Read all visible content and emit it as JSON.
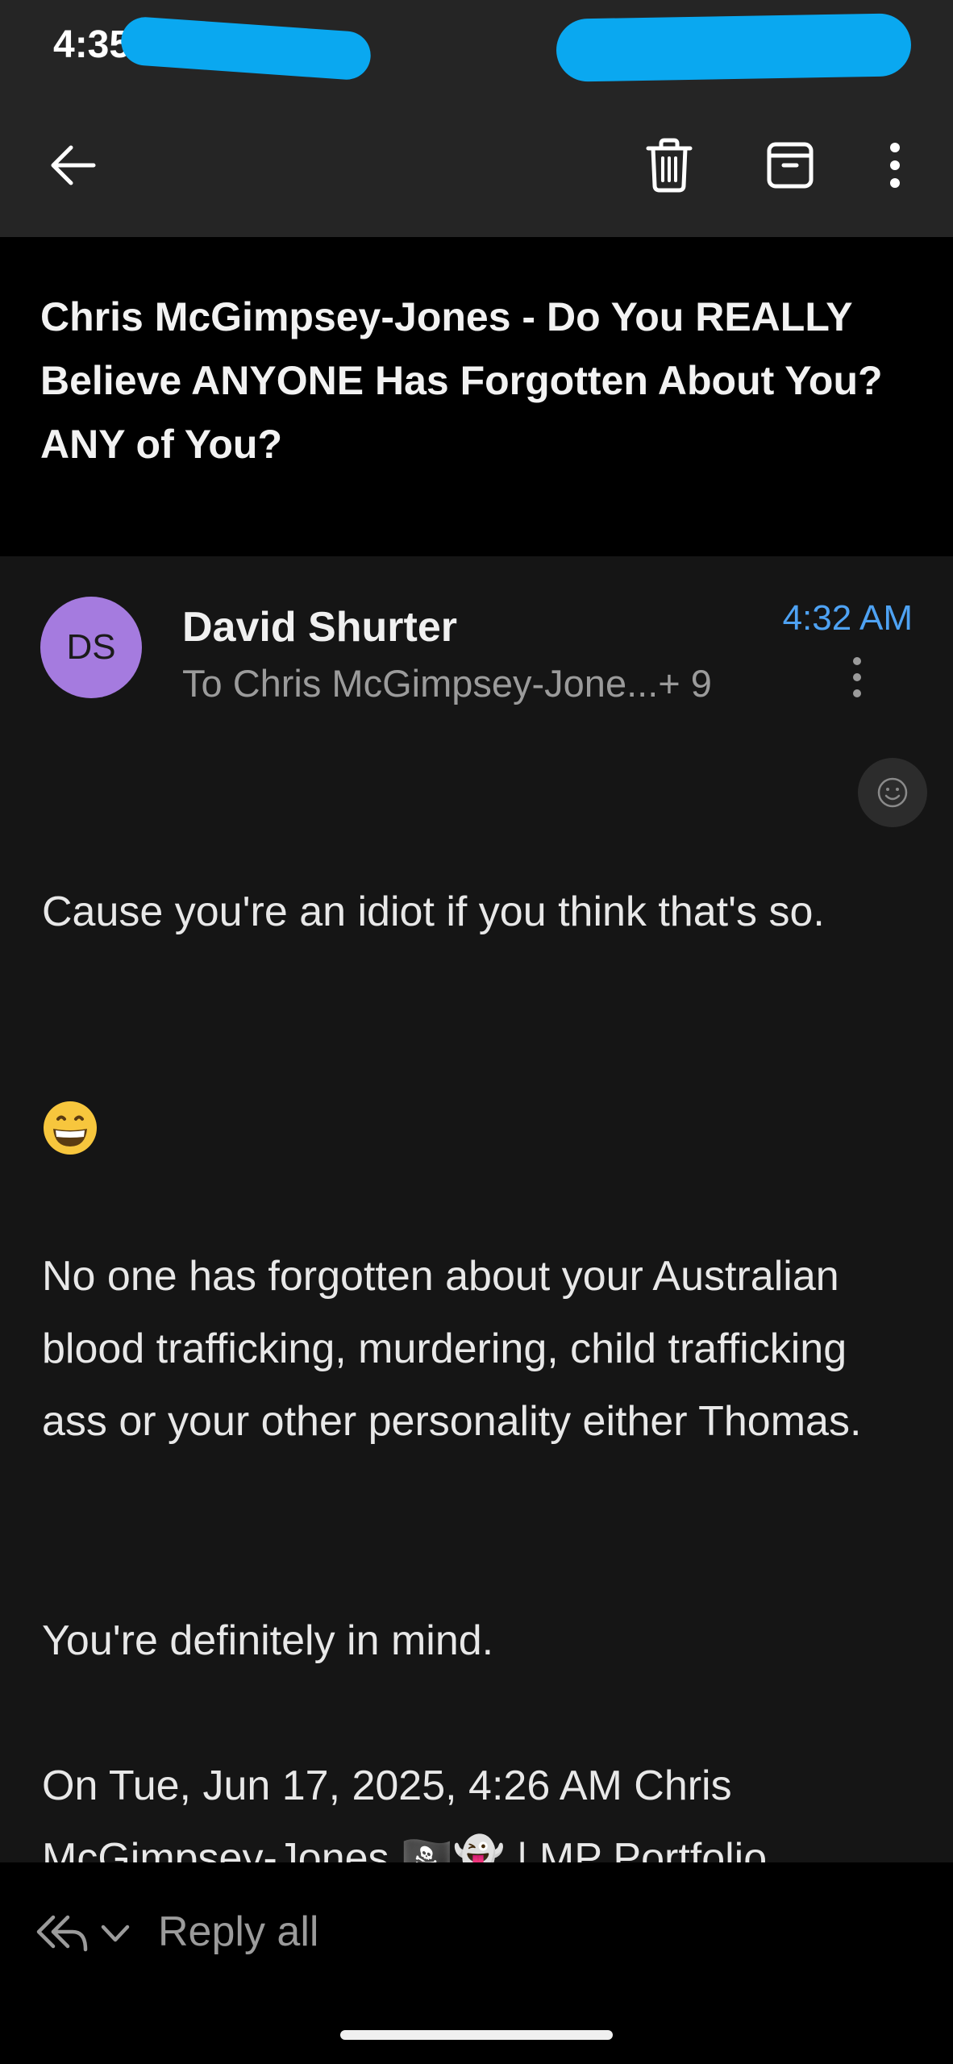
{
  "status_bar": {
    "time": "4:35"
  },
  "toolbar": {
    "back_icon": "arrow-left-icon",
    "delete_icon": "trash-icon",
    "archive_icon": "archive-icon",
    "more_icon": "more-vertical-icon"
  },
  "email": {
    "subject": "Chris McGimpsey-Jones - Do You REALLY Believe ANYONE Has Forgotten About You? ANY of You?",
    "avatar_initials": "DS",
    "sender": "David Shurter",
    "recipients": "To Chris McGimpsey-Jone...+ 9",
    "time": "4:32 AM",
    "body": {
      "p1": "Cause you're an idiot if you think that's so.",
      "emoji": "grinning-face-emoji",
      "p2": "No one has forgotten about your Australian blood trafficking, murdering, child trafficking ass or your other personality either Thomas.",
      "p3": "You're definitely in mind.",
      "p4_line1": "On Tue, Jun 17, 2025, 4:26 AM Chris",
      "p4_line2": "McGimpsey-Jones 🏴‍☠️👻 | MP Portfolio"
    }
  },
  "bottom_bar": {
    "reply_all_label": "Reply all"
  },
  "colors": {
    "accent_time": "#4ea2f3",
    "avatar": "#a57bdf",
    "redaction": "#0aa8f0"
  }
}
